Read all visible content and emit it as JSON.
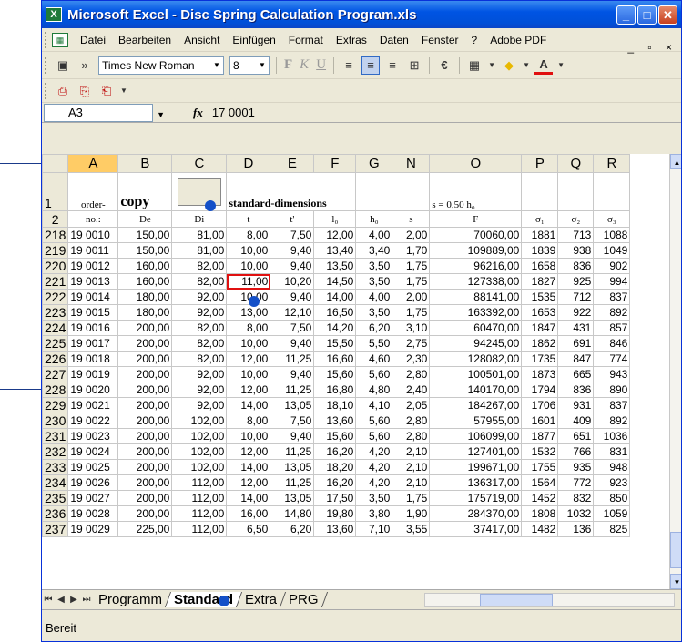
{
  "window": {
    "title": "Microsoft Excel - Disc Spring Calculation Program.xls"
  },
  "menu": [
    "Datei",
    "Bearbeiten",
    "Ansicht",
    "Einfügen",
    "Format",
    "Extras",
    "Daten",
    "Fenster",
    "?",
    "Adobe PDF"
  ],
  "toolbar": {
    "font": "Times New Roman",
    "size": "8"
  },
  "formula_bar": {
    "name_box": "A3",
    "fx": "fx",
    "value": "17 0001"
  },
  "columns": [
    "A",
    "B",
    "C",
    "D",
    "E",
    "F",
    "G",
    "N",
    "O",
    "P",
    "Q",
    "R"
  ],
  "header_rows": {
    "row1": {
      "num": "1",
      "a": "order-",
      "b": "copy",
      "d": "standard-dimensions",
      "o": "s = 0,50 h₀"
    },
    "row2": {
      "num": "2",
      "cells": [
        "no.:",
        "De",
        "Di",
        "t",
        "t'",
        "l₀",
        "h₀",
        "s",
        "F",
        "σ₁",
        "σ₂",
        "σ₃"
      ]
    }
  },
  "rows": [
    [
      "218",
      "19 0010",
      "150,00",
      "81,00",
      "8,00",
      "7,50",
      "12,00",
      "4,00",
      "2,00",
      "70060,00",
      "1881",
      "713",
      "1088"
    ],
    [
      "219",
      "19 0011",
      "150,00",
      "81,00",
      "10,00",
      "9,40",
      "13,40",
      "3,40",
      "1,70",
      "109889,00",
      "1839",
      "938",
      "1049"
    ],
    [
      "220",
      "19 0012",
      "160,00",
      "82,00",
      "10,00",
      "9,40",
      "13,50",
      "3,50",
      "1,75",
      "96216,00",
      "1658",
      "836",
      "902"
    ],
    [
      "221",
      "19 0013",
      "160,00",
      "82,00",
      "11,00",
      "10,20",
      "14,50",
      "3,50",
      "1,75",
      "127338,00",
      "1827",
      "925",
      "994"
    ],
    [
      "222",
      "19 0014",
      "180,00",
      "92,00",
      "10,00",
      "9,40",
      "14,00",
      "4,00",
      "2,00",
      "88141,00",
      "1535",
      "712",
      "837"
    ],
    [
      "223",
      "19 0015",
      "180,00",
      "92,00",
      "13,00",
      "12,10",
      "16,50",
      "3,50",
      "1,75",
      "163392,00",
      "1653",
      "922",
      "892"
    ],
    [
      "224",
      "19 0016",
      "200,00",
      "82,00",
      "8,00",
      "7,50",
      "14,20",
      "6,20",
      "3,10",
      "60470,00",
      "1847",
      "431",
      "857"
    ],
    [
      "225",
      "19 0017",
      "200,00",
      "82,00",
      "10,00",
      "9,40",
      "15,50",
      "5,50",
      "2,75",
      "94245,00",
      "1862",
      "691",
      "846"
    ],
    [
      "226",
      "19 0018",
      "200,00",
      "82,00",
      "12,00",
      "11,25",
      "16,60",
      "4,60",
      "2,30",
      "128082,00",
      "1735",
      "847",
      "774"
    ],
    [
      "227",
      "19 0019",
      "200,00",
      "92,00",
      "10,00",
      "9,40",
      "15,60",
      "5,60",
      "2,80",
      "100501,00",
      "1873",
      "665",
      "943"
    ],
    [
      "228",
      "19 0020",
      "200,00",
      "92,00",
      "12,00",
      "11,25",
      "16,80",
      "4,80",
      "2,40",
      "140170,00",
      "1794",
      "836",
      "890"
    ],
    [
      "229",
      "19 0021",
      "200,00",
      "92,00",
      "14,00",
      "13,05",
      "18,10",
      "4,10",
      "2,05",
      "184267,00",
      "1706",
      "931",
      "837"
    ],
    [
      "230",
      "19 0022",
      "200,00",
      "102,00",
      "8,00",
      "7,50",
      "13,60",
      "5,60",
      "2,80",
      "57955,00",
      "1601",
      "409",
      "892"
    ],
    [
      "231",
      "19 0023",
      "200,00",
      "102,00",
      "10,00",
      "9,40",
      "15,60",
      "5,60",
      "2,80",
      "106099,00",
      "1877",
      "651",
      "1036"
    ],
    [
      "232",
      "19 0024",
      "200,00",
      "102,00",
      "12,00",
      "11,25",
      "16,20",
      "4,20",
      "2,10",
      "127401,00",
      "1532",
      "766",
      "831"
    ],
    [
      "233",
      "19 0025",
      "200,00",
      "102,00",
      "14,00",
      "13,05",
      "18,20",
      "4,20",
      "2,10",
      "199671,00",
      "1755",
      "935",
      "948"
    ],
    [
      "234",
      "19 0026",
      "200,00",
      "112,00",
      "12,00",
      "11,25",
      "16,20",
      "4,20",
      "2,10",
      "136317,00",
      "1564",
      "772",
      "923"
    ],
    [
      "235",
      "19 0027",
      "200,00",
      "112,00",
      "14,00",
      "13,05",
      "17,50",
      "3,50",
      "1,75",
      "175719,00",
      "1452",
      "832",
      "850"
    ],
    [
      "236",
      "19 0028",
      "200,00",
      "112,00",
      "16,00",
      "14,80",
      "19,80",
      "3,80",
      "1,90",
      "284370,00",
      "1808",
      "1032",
      "1059"
    ],
    [
      "237",
      "19 0029",
      "225,00",
      "112,00",
      "6,50",
      "6,20",
      "13,60",
      "7,10",
      "3,55",
      "37417,00",
      "1482",
      "136",
      "825"
    ]
  ],
  "sheet_tabs": [
    "Programm",
    "Standard",
    "Extra",
    "PRG"
  ],
  "active_tab": "Standard",
  "status": "Bereit"
}
